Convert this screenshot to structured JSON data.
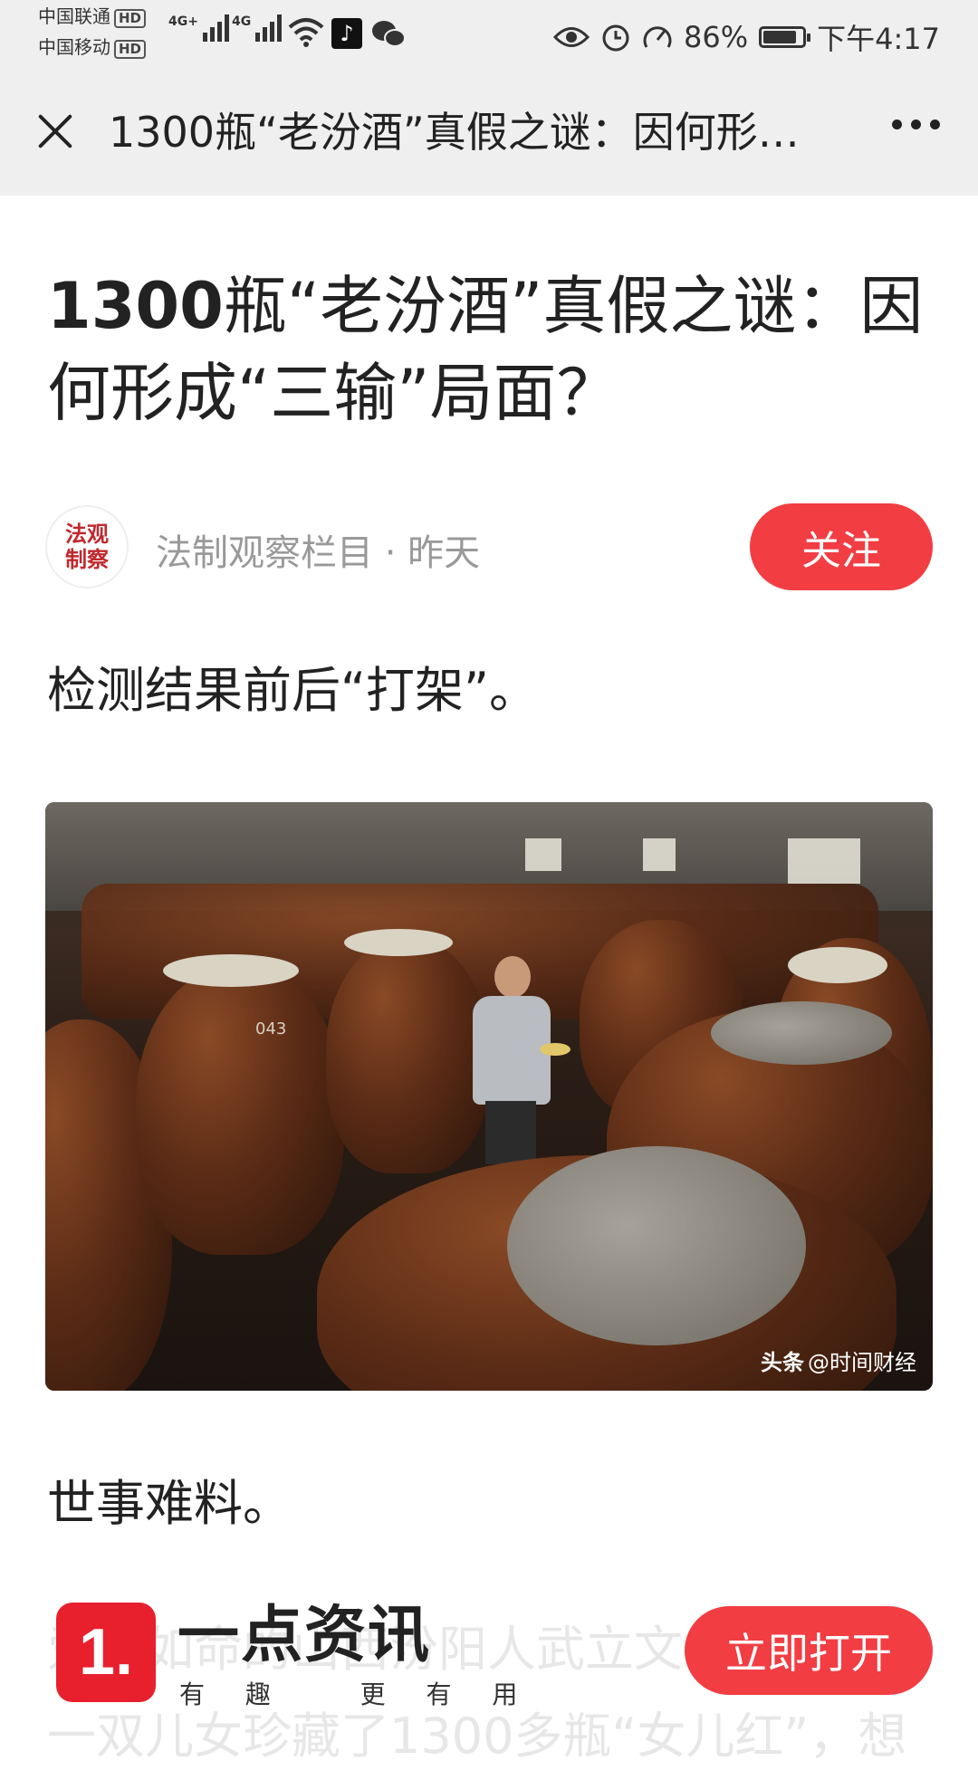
{
  "status_bar": {
    "carrier1": "中国联通",
    "carrier2": "中国移动",
    "hd_label": "HD",
    "net1": "4G+",
    "net2": "4G",
    "battery_pct": "86%",
    "battery_level": 0.86,
    "time": "下午4:17",
    "icons": [
      "wifi-icon",
      "tiktok-icon",
      "wechat-icon",
      "eye-icon",
      "alarm-icon",
      "speed-icon",
      "battery-icon"
    ]
  },
  "navbar": {
    "title": "1300瓶“老汾酒”真假之谜：因何形成“三输”局面？"
  },
  "article": {
    "title_bold": "1300",
    "title_rest": "瓶“老汾酒”真假之谜：因何形成“三输”局面？",
    "author_logo_text": "法观制察",
    "author_line": "法制观察栏目 · 昨天",
    "follow_label": "关注",
    "para1": "检测结果前后“打架”。",
    "photo_watermark_brand": "头条",
    "photo_watermark_user": "@时间财经",
    "photo_jar_number": "043",
    "para2": "世事难料。",
    "faded_text_line1": "爱子如命的山西汾阳人武立文，因为",
    "faded_text_line2": "一双儿女珍藏了1300多瓶“女儿红”，想"
  },
  "banner": {
    "logo_mark": "1.",
    "app_name": "一点资讯",
    "slogan": "有 趣   更 有 用",
    "open_label": "立即打开"
  }
}
